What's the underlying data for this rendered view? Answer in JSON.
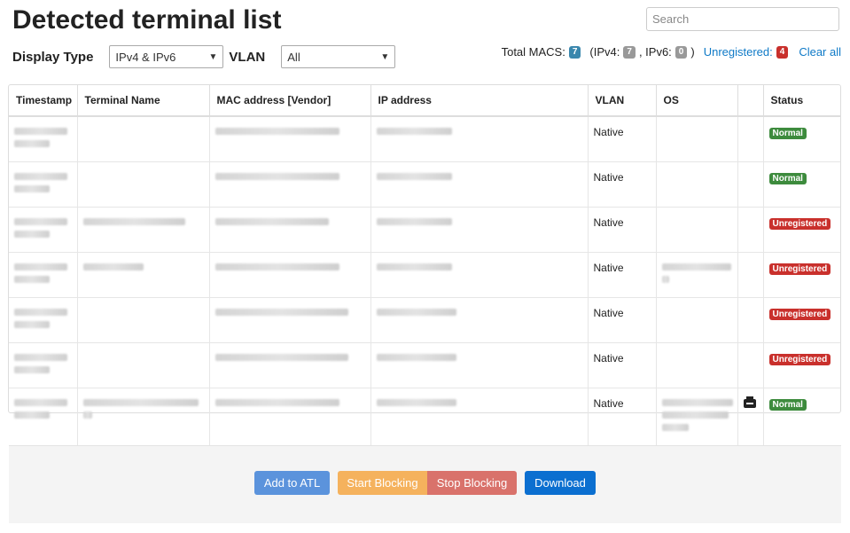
{
  "page": {
    "title": "Detected terminal list"
  },
  "search": {
    "placeholder": "Search"
  },
  "filters": {
    "display_type_label": "Display Type",
    "display_type_value": "IPv4 & IPv6",
    "vlan_label": "VLAN",
    "vlan_value": "All"
  },
  "stats": {
    "total_label": "Total MACS:",
    "total": "7",
    "ipv4_label": "(IPv4:",
    "ipv4": "7",
    "ipv6_label": ", IPv6:",
    "ipv6": "0",
    "close_paren": ")",
    "unregistered_label": "Unregistered:",
    "unregistered": "4",
    "clear_all": "Clear all"
  },
  "table": {
    "columns": [
      "Timestamp",
      "Terminal Name",
      "MAC address [Vendor]",
      "IP address",
      "VLAN",
      "OS",
      "",
      "Status"
    ],
    "rows": [
      {
        "vlan": "Native",
        "status": "Normal"
      },
      {
        "vlan": "Native",
        "status": "Normal"
      },
      {
        "vlan": "Native",
        "status": "Unregistered"
      },
      {
        "vlan": "Native",
        "status": "Unregistered"
      },
      {
        "vlan": "Native",
        "status": "Unregistered"
      },
      {
        "vlan": "Native",
        "status": "Unregistered"
      },
      {
        "vlan": "Native",
        "status": "Normal"
      }
    ]
  },
  "footer": {
    "add_to_atl": "Add to ATL",
    "start_blocking": "Start Blocking",
    "stop_blocking": "Stop Blocking",
    "download": "Download"
  },
  "colors": {
    "normal": "#3d8b3d",
    "unregistered": "#c9302c",
    "add_btn": "#5b93dc",
    "start_btn": "#f5b25d",
    "stop_btn": "#d9726b",
    "download_btn": "#0b6fd0"
  }
}
